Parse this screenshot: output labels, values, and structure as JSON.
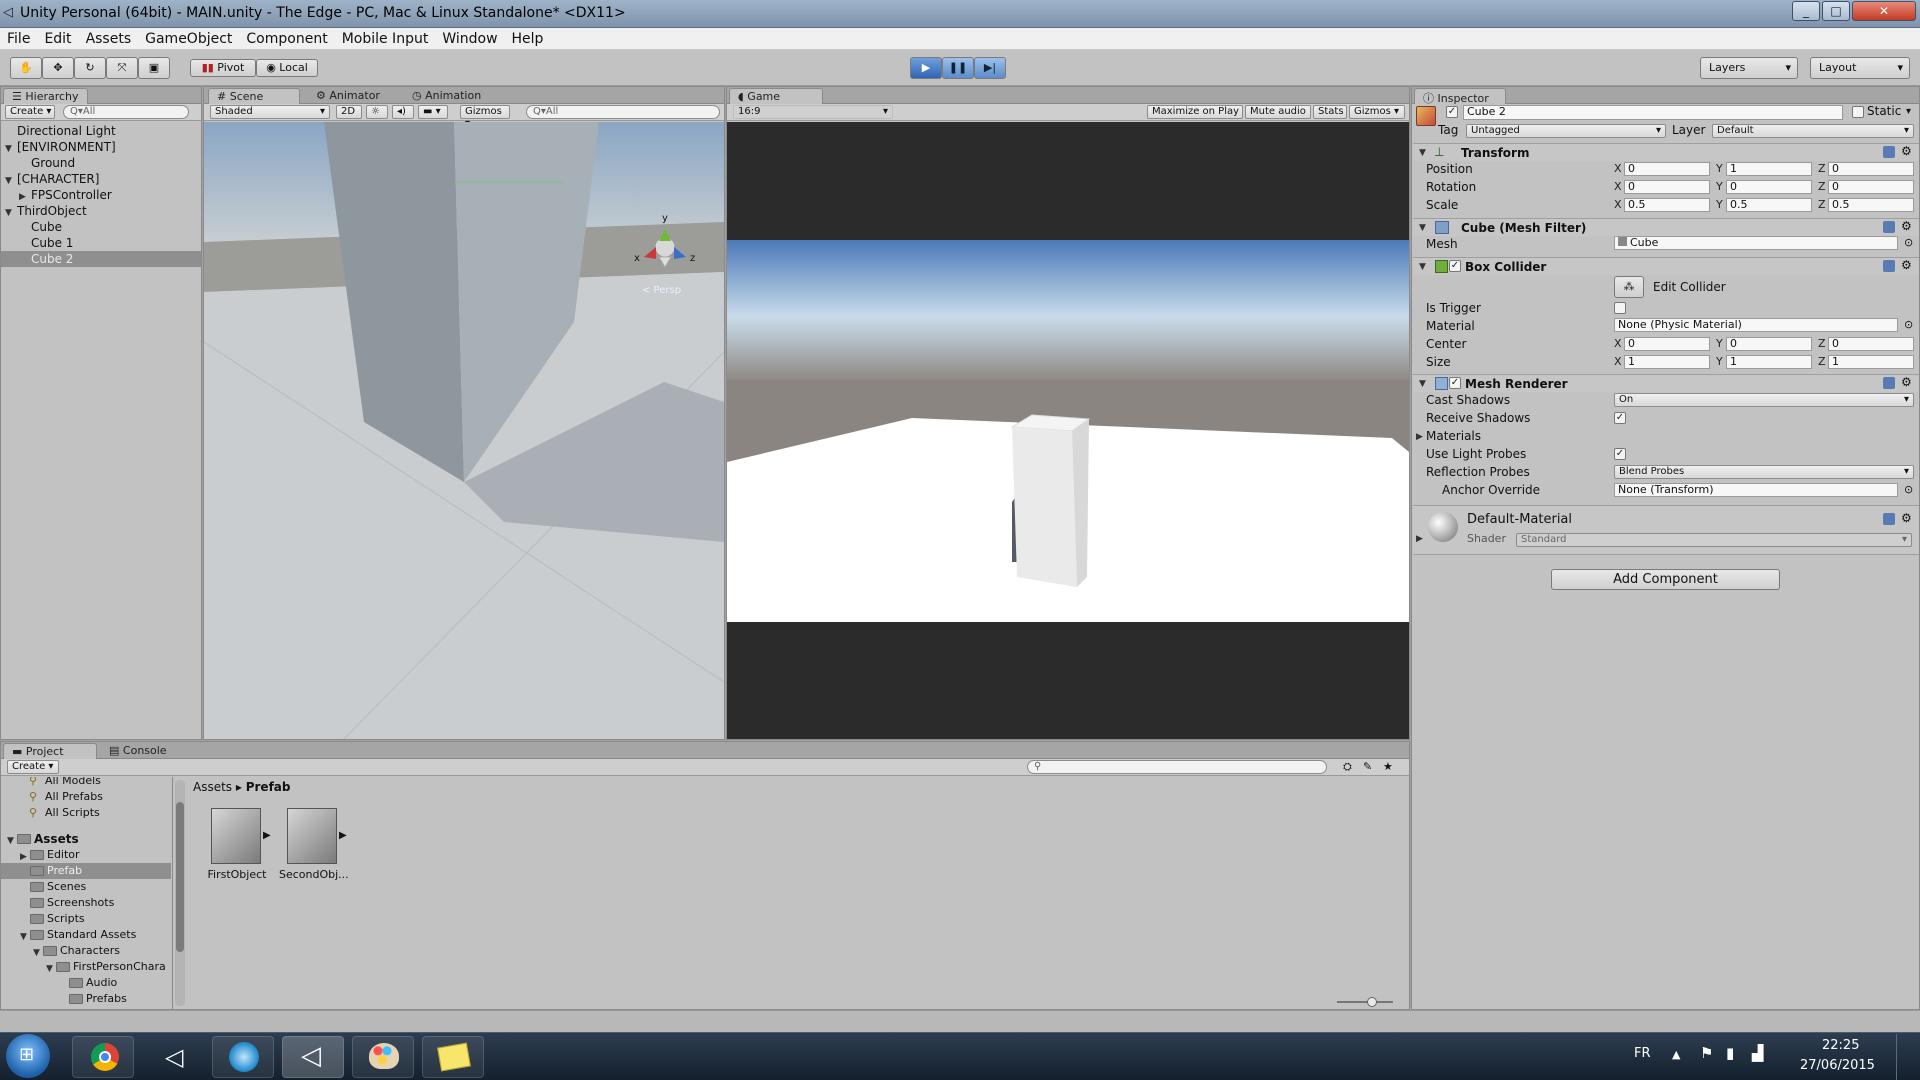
{
  "window": {
    "title": "Unity Personal (64bit) - MAIN.unity - The Edge - PC, Mac & Linux Standalone* <DX11>"
  },
  "menu": [
    "File",
    "Edit",
    "Assets",
    "GameObject",
    "Component",
    "Mobile Input",
    "Window",
    "Help"
  ],
  "toolbar": {
    "pivot": "Pivot",
    "local": "Local",
    "layers": "Layers",
    "layout": "Layout"
  },
  "hierarchy": {
    "tab": "Hierarchy",
    "create": "Create",
    "search": "Q▾All",
    "items": [
      {
        "label": "Directional Light",
        "indent": 0,
        "arrow": ""
      },
      {
        "label": "[ENVIRONMENT]",
        "indent": 0,
        "arrow": "▼"
      },
      {
        "label": "Ground",
        "indent": 1,
        "arrow": ""
      },
      {
        "label": "[CHARACTER]",
        "indent": 0,
        "arrow": "▼"
      },
      {
        "label": "FPSController",
        "indent": 1,
        "arrow": "▶"
      },
      {
        "label": "ThirdObject",
        "indent": 0,
        "arrow": "▼"
      },
      {
        "label": "Cube",
        "indent": 1,
        "arrow": ""
      },
      {
        "label": "Cube 1",
        "indent": 1,
        "arrow": ""
      },
      {
        "label": "Cube 2",
        "indent": 1,
        "arrow": "",
        "selected": true
      }
    ]
  },
  "scene": {
    "tabs": [
      "Scene",
      "Animator",
      "Animation"
    ],
    "shading": "Shaded",
    "mode2d": "2D",
    "gizmos": "Gizmos",
    "search": "Q▾All",
    "persp": "< Persp",
    "axis_y": "y",
    "axis_x": "x",
    "axis_z": "z"
  },
  "game": {
    "tab": "Game",
    "aspect": "16:9",
    "maximize": "Maximize on Play",
    "mute": "Mute audio",
    "stats": "Stats",
    "gizmos": "Gizmos"
  },
  "inspector": {
    "tab": "Inspector",
    "object_name": "Cube 2",
    "static": "Static",
    "tag_label": "Tag",
    "tag": "Untagged",
    "layer_label": "Layer",
    "layer": "Default",
    "transform": {
      "title": "Transform",
      "position_label": "Position",
      "rotation_label": "Rotation",
      "scale_label": "Scale",
      "position": [
        "0",
        "1",
        "0"
      ],
      "rotation": [
        "0",
        "0",
        "0"
      ],
      "scale": [
        "0.5",
        "0.5",
        "0.5"
      ]
    },
    "mesh_filter": {
      "title": "Cube (Mesh Filter)",
      "mesh_label": "Mesh",
      "mesh": "Cube"
    },
    "box_collider": {
      "title": "Box Collider",
      "edit": "Edit Collider",
      "trigger_label": "Is Trigger",
      "material_label": "Material",
      "material": "None (Physic Material)",
      "center_label": "Center",
      "size_label": "Size",
      "center": [
        "0",
        "0",
        "0"
      ],
      "size": [
        "1",
        "1",
        "1"
      ]
    },
    "mesh_renderer": {
      "title": "Mesh Renderer",
      "cast_label": "Cast Shadows",
      "cast": "On",
      "receive_label": "Receive Shadows",
      "materials_label": "Materials",
      "probes_label": "Use Light Probes",
      "reflection_label": "Reflection Probes",
      "reflection": "Blend Probes",
      "anchor_label": "Anchor Override",
      "anchor": "None (Transform)"
    },
    "material": {
      "name": "Default-Material",
      "shader_label": "Shader",
      "shader": "Standard"
    },
    "add_component": "Add Component",
    "x": "X",
    "y": "Y",
    "z": "Z"
  },
  "project": {
    "tabs": [
      "Project",
      "Console"
    ],
    "create": "Create",
    "breadcrumb_root": "Assets",
    "breadcrumb_current": "Prefab",
    "favorites": [
      "All Models",
      "All Prefabs",
      "All Scripts"
    ],
    "tree": [
      {
        "label": "Assets",
        "indent": 0,
        "arrow": "▼",
        "bold": true
      },
      {
        "label": "Editor",
        "indent": 1,
        "arrow": "▶"
      },
      {
        "label": "Prefab",
        "indent": 1,
        "arrow": "",
        "selected": true
      },
      {
        "label": "Scenes",
        "indent": 1,
        "arrow": ""
      },
      {
        "label": "Screenshots",
        "indent": 1,
        "arrow": ""
      },
      {
        "label": "Scripts",
        "indent": 1,
        "arrow": ""
      },
      {
        "label": "Standard Assets",
        "indent": 1,
        "arrow": "▼"
      },
      {
        "label": "Characters",
        "indent": 2,
        "arrow": "▼"
      },
      {
        "label": "FirstPersonChara",
        "indent": 3,
        "arrow": "▼"
      },
      {
        "label": "Audio",
        "indent": 4,
        "arrow": ""
      },
      {
        "label": "Prefabs",
        "indent": 4,
        "arrow": ""
      }
    ],
    "assets": [
      "FirstObject",
      "SecondObj..."
    ]
  },
  "taskbar": {
    "lang": "FR",
    "time": "22:25",
    "date": "27/06/2015"
  }
}
